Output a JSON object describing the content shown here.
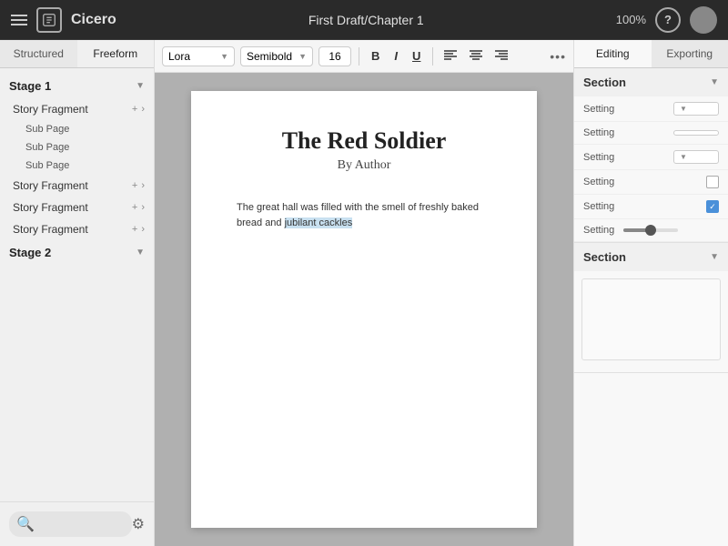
{
  "topbar": {
    "title": "First Draft/Chapter 1",
    "zoom": "100%",
    "help_label": "?",
    "app_name": "Cicero"
  },
  "sidebar": {
    "tab_structured": "Structured",
    "tab_freeform": "Freeform",
    "stage1_label": "Stage 1",
    "stage2_label": "Stage 2",
    "items": [
      {
        "label": "Story Fragment",
        "type": "fragment"
      },
      {
        "label": "Sub Page",
        "type": "subpage"
      },
      {
        "label": "Sub Page",
        "type": "subpage"
      },
      {
        "label": "Sub Page",
        "type": "subpage"
      },
      {
        "label": "Story Fragment",
        "type": "fragment"
      },
      {
        "label": "Story Fragment",
        "type": "fragment"
      },
      {
        "label": "Story Fragment",
        "type": "fragment"
      }
    ],
    "search_placeholder": ""
  },
  "toolbar": {
    "font": "Lora",
    "weight": "Semibold",
    "size": "16",
    "bold_label": "B",
    "italic_label": "I",
    "underline_label": "U",
    "more_label": "•••"
  },
  "editor": {
    "page_title": "The Red Soldier",
    "page_author": "By Author",
    "body_text_normal": "The great hall was filled with the smell of freshly baked bread and ",
    "body_text_highlighted": "jubilant cackles"
  },
  "right_panel": {
    "tab_editing": "Editing",
    "tab_exporting": "Exporting",
    "section1_label": "Section",
    "section2_label": "Section",
    "settings": [
      {
        "label": "Setting",
        "type": "dropdown",
        "value": ""
      },
      {
        "label": "Setting",
        "type": "dropdown",
        "value": ""
      },
      {
        "label": "Setting",
        "type": "dropdown",
        "value": ""
      },
      {
        "label": "Setting",
        "type": "checkbox",
        "checked": false
      },
      {
        "label": "Setting",
        "type": "checkbox",
        "checked": true
      },
      {
        "label": "Setting",
        "type": "slider"
      }
    ]
  }
}
